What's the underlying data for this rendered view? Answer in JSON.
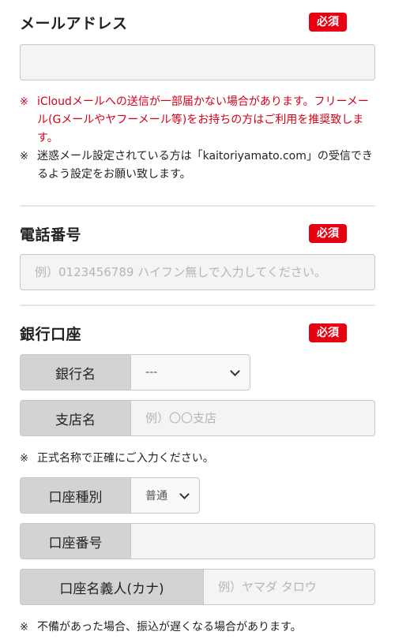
{
  "required_label": "必須",
  "note_mark": "※",
  "email": {
    "title": "メールアドレス",
    "value": "",
    "placeholder": "",
    "notes_red": [
      "iCloudメールへの送信が一部届かない場合があります。フリーメール(Gメールやヤフーメール等)をお持ちの方はご利用を推奨致します。"
    ],
    "notes": [
      "迷惑メール設定されている方は「kaitoriyamato.com」の受信できるよう設定をお願い致します。"
    ]
  },
  "phone": {
    "title": "電話番号",
    "value": "",
    "placeholder": "例）0123456789 ハイフン無しで入力してください。"
  },
  "bank": {
    "title": "銀行口座",
    "bank_name": {
      "label": "銀行名",
      "selected": "---"
    },
    "branch_name": {
      "label": "支店名",
      "placeholder": "例）〇〇支店",
      "value": ""
    },
    "branch_note": "正式名称で正確にご入力ください。",
    "account_type": {
      "label": "口座種別",
      "selected": "普通"
    },
    "account_number": {
      "label": "口座番号",
      "value": ""
    },
    "account_holder": {
      "label": "口座名義人(カナ)",
      "placeholder": "例）ヤマダ タロウ",
      "value": ""
    },
    "final_note": "不備があった場合、振込が遅くなる場合があります。"
  },
  "colors": {
    "required_badge": "#e60012",
    "warning_text": "#d4001a",
    "label_bg": "#d3d3d3",
    "input_bg": "#f4f4f4"
  }
}
